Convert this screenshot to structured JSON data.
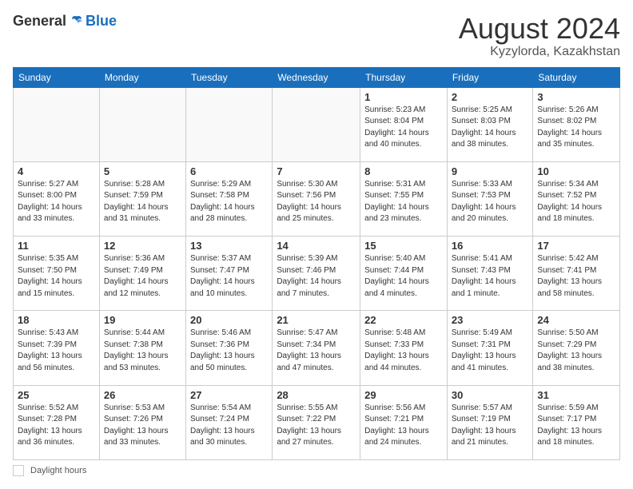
{
  "header": {
    "logo_general": "General",
    "logo_blue": "Blue",
    "month_year": "August 2024",
    "location": "Kyzylorda, Kazakhstan"
  },
  "footer": {
    "daylight_label": "Daylight hours"
  },
  "days_of_week": [
    "Sunday",
    "Monday",
    "Tuesday",
    "Wednesday",
    "Thursday",
    "Friday",
    "Saturday"
  ],
  "weeks": [
    [
      {
        "day": "",
        "info": ""
      },
      {
        "day": "",
        "info": ""
      },
      {
        "day": "",
        "info": ""
      },
      {
        "day": "",
        "info": ""
      },
      {
        "day": "1",
        "info": "Sunrise: 5:23 AM\nSunset: 8:04 PM\nDaylight: 14 hours\nand 40 minutes."
      },
      {
        "day": "2",
        "info": "Sunrise: 5:25 AM\nSunset: 8:03 PM\nDaylight: 14 hours\nand 38 minutes."
      },
      {
        "day": "3",
        "info": "Sunrise: 5:26 AM\nSunset: 8:02 PM\nDaylight: 14 hours\nand 35 minutes."
      }
    ],
    [
      {
        "day": "4",
        "info": "Sunrise: 5:27 AM\nSunset: 8:00 PM\nDaylight: 14 hours\nand 33 minutes."
      },
      {
        "day": "5",
        "info": "Sunrise: 5:28 AM\nSunset: 7:59 PM\nDaylight: 14 hours\nand 31 minutes."
      },
      {
        "day": "6",
        "info": "Sunrise: 5:29 AM\nSunset: 7:58 PM\nDaylight: 14 hours\nand 28 minutes."
      },
      {
        "day": "7",
        "info": "Sunrise: 5:30 AM\nSunset: 7:56 PM\nDaylight: 14 hours\nand 25 minutes."
      },
      {
        "day": "8",
        "info": "Sunrise: 5:31 AM\nSunset: 7:55 PM\nDaylight: 14 hours\nand 23 minutes."
      },
      {
        "day": "9",
        "info": "Sunrise: 5:33 AM\nSunset: 7:53 PM\nDaylight: 14 hours\nand 20 minutes."
      },
      {
        "day": "10",
        "info": "Sunrise: 5:34 AM\nSunset: 7:52 PM\nDaylight: 14 hours\nand 18 minutes."
      }
    ],
    [
      {
        "day": "11",
        "info": "Sunrise: 5:35 AM\nSunset: 7:50 PM\nDaylight: 14 hours\nand 15 minutes."
      },
      {
        "day": "12",
        "info": "Sunrise: 5:36 AM\nSunset: 7:49 PM\nDaylight: 14 hours\nand 12 minutes."
      },
      {
        "day": "13",
        "info": "Sunrise: 5:37 AM\nSunset: 7:47 PM\nDaylight: 14 hours\nand 10 minutes."
      },
      {
        "day": "14",
        "info": "Sunrise: 5:39 AM\nSunset: 7:46 PM\nDaylight: 14 hours\nand 7 minutes."
      },
      {
        "day": "15",
        "info": "Sunrise: 5:40 AM\nSunset: 7:44 PM\nDaylight: 14 hours\nand 4 minutes."
      },
      {
        "day": "16",
        "info": "Sunrise: 5:41 AM\nSunset: 7:43 PM\nDaylight: 14 hours\nand 1 minute."
      },
      {
        "day": "17",
        "info": "Sunrise: 5:42 AM\nSunset: 7:41 PM\nDaylight: 13 hours\nand 58 minutes."
      }
    ],
    [
      {
        "day": "18",
        "info": "Sunrise: 5:43 AM\nSunset: 7:39 PM\nDaylight: 13 hours\nand 56 minutes."
      },
      {
        "day": "19",
        "info": "Sunrise: 5:44 AM\nSunset: 7:38 PM\nDaylight: 13 hours\nand 53 minutes."
      },
      {
        "day": "20",
        "info": "Sunrise: 5:46 AM\nSunset: 7:36 PM\nDaylight: 13 hours\nand 50 minutes."
      },
      {
        "day": "21",
        "info": "Sunrise: 5:47 AM\nSunset: 7:34 PM\nDaylight: 13 hours\nand 47 minutes."
      },
      {
        "day": "22",
        "info": "Sunrise: 5:48 AM\nSunset: 7:33 PM\nDaylight: 13 hours\nand 44 minutes."
      },
      {
        "day": "23",
        "info": "Sunrise: 5:49 AM\nSunset: 7:31 PM\nDaylight: 13 hours\nand 41 minutes."
      },
      {
        "day": "24",
        "info": "Sunrise: 5:50 AM\nSunset: 7:29 PM\nDaylight: 13 hours\nand 38 minutes."
      }
    ],
    [
      {
        "day": "25",
        "info": "Sunrise: 5:52 AM\nSunset: 7:28 PM\nDaylight: 13 hours\nand 36 minutes."
      },
      {
        "day": "26",
        "info": "Sunrise: 5:53 AM\nSunset: 7:26 PM\nDaylight: 13 hours\nand 33 minutes."
      },
      {
        "day": "27",
        "info": "Sunrise: 5:54 AM\nSunset: 7:24 PM\nDaylight: 13 hours\nand 30 minutes."
      },
      {
        "day": "28",
        "info": "Sunrise: 5:55 AM\nSunset: 7:22 PM\nDaylight: 13 hours\nand 27 minutes."
      },
      {
        "day": "29",
        "info": "Sunrise: 5:56 AM\nSunset: 7:21 PM\nDaylight: 13 hours\nand 24 minutes."
      },
      {
        "day": "30",
        "info": "Sunrise: 5:57 AM\nSunset: 7:19 PM\nDaylight: 13 hours\nand 21 minutes."
      },
      {
        "day": "31",
        "info": "Sunrise: 5:59 AM\nSunset: 7:17 PM\nDaylight: 13 hours\nand 18 minutes."
      }
    ]
  ]
}
